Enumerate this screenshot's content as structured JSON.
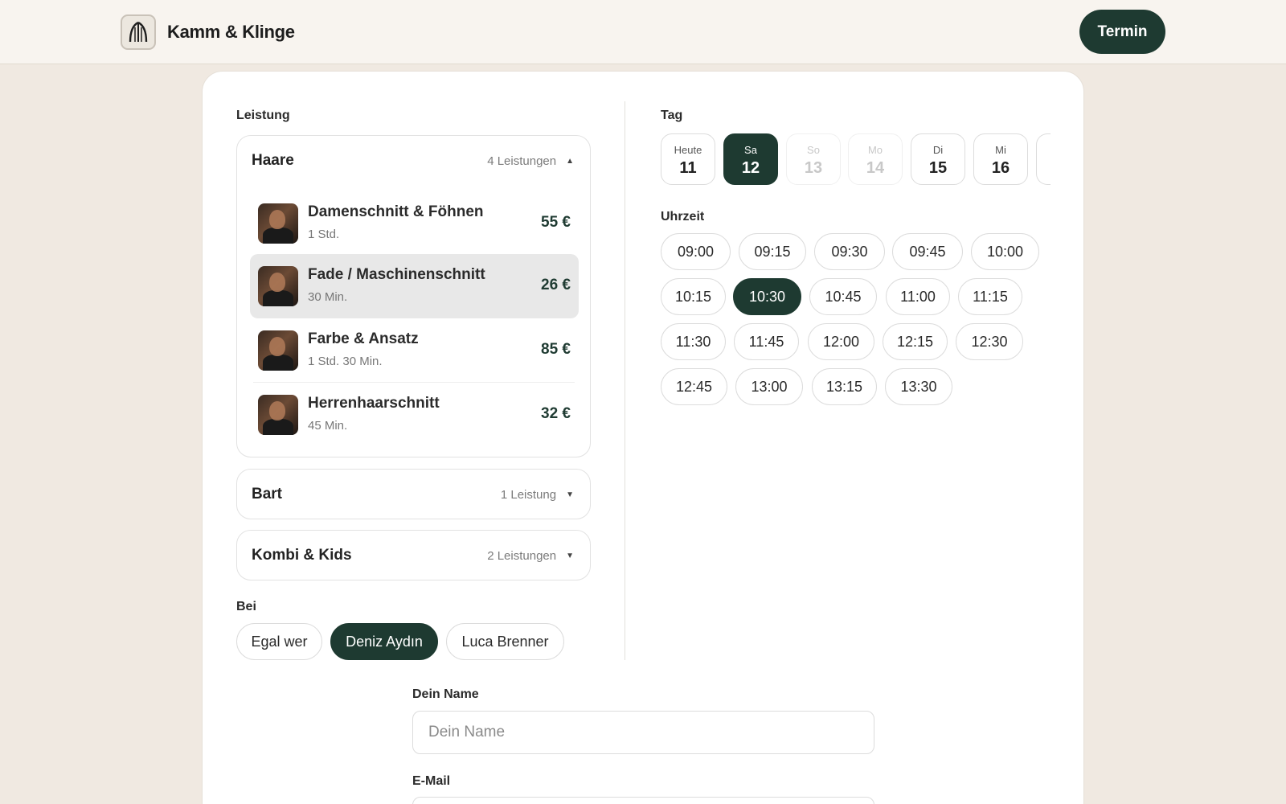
{
  "header": {
    "brand": "Kamm & Klinge",
    "cta_label": "Termin"
  },
  "service": {
    "label": "Leistung",
    "groups": [
      {
        "title": "Haare",
        "count": "4 Leistungen",
        "caret": "▲",
        "items": [
          {
            "name": "Damenschnitt & Föhnen",
            "duration": "1 Std.",
            "price": "55 €"
          },
          {
            "name": "Fade / Maschinenschnitt",
            "duration": "30 Min.",
            "price": "26 €",
            "selected": true
          },
          {
            "name": "Farbe & Ansatz",
            "duration": "1 Std. 30 Min.",
            "price": "85 €"
          },
          {
            "name": "Herrenhaarschnitt",
            "duration": "45 Min.",
            "price": "32 €"
          }
        ]
      },
      {
        "title": "Bart",
        "count": "1 Leistung",
        "caret": "▼"
      },
      {
        "title": "Kombi & Kids",
        "count": "2 Leistungen",
        "caret": "▼"
      }
    ]
  },
  "staff": {
    "label": "Bei",
    "options": [
      "Egal wer",
      "Deniz Aydın",
      "Luca Brenner"
    ],
    "selected": "Deniz Aydın"
  },
  "day": {
    "label": "Tag",
    "days": [
      {
        "weekday": "Heute",
        "date": "11"
      },
      {
        "weekday": "Sa",
        "date": "12",
        "selected": true
      },
      {
        "weekday": "So",
        "date": "13",
        "disabled": true
      },
      {
        "weekday": "Mo",
        "date": "14",
        "disabled": true
      },
      {
        "weekday": "Di",
        "date": "15"
      },
      {
        "weekday": "Mi",
        "date": "16"
      }
    ]
  },
  "time": {
    "label": "Uhrzeit",
    "slots": [
      "09:00",
      "09:15",
      "09:30",
      "09:45",
      "10:00",
      "10:15",
      "10:30",
      "10:45",
      "11:00",
      "11:15",
      "11:30",
      "11:45",
      "12:00",
      "12:15",
      "12:30",
      "12:45",
      "13:00",
      "13:15",
      "13:30"
    ],
    "selected": "10:30"
  },
  "form": {
    "name_label": "Dein Name",
    "name_placeholder": "Dein Name",
    "name_value": "",
    "email_label": "E-Mail"
  },
  "colors": {
    "accent": "#1e3a31",
    "page_bg": "#f0e9e1",
    "header_bg": "#f8f4ef"
  }
}
